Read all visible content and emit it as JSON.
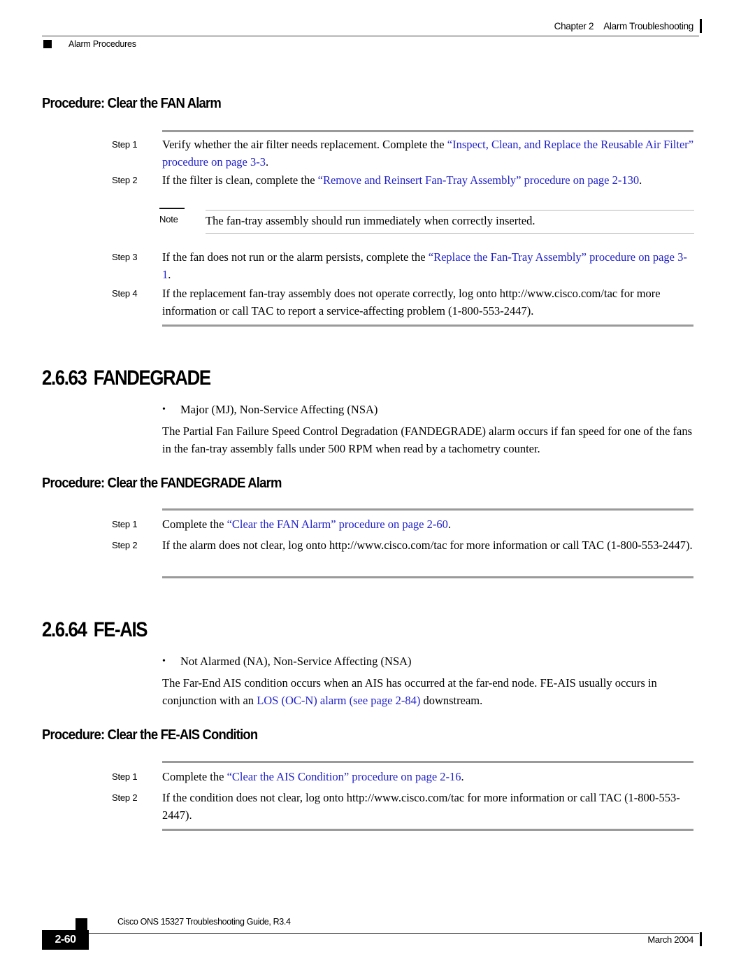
{
  "header": {
    "chapter_number": "Chapter 2",
    "chapter_title": "Alarm Troubleshooting",
    "section_label": "Alarm Procedures"
  },
  "proc_fan": {
    "heading": "Procedure: Clear the FAN Alarm",
    "steps": [
      {
        "label": "Step 1",
        "text_before": "Verify whether the air filter needs replacement. Complete the ",
        "link": "“Inspect, Clean, and Replace the Reusable Air Filter” procedure on page 3-3",
        "text_after": "."
      },
      {
        "label": "Step 2",
        "text_before": "If the filter is clean, complete the ",
        "link": "“Remove and Reinsert Fan-Tray Assembly” procedure on page 2-130",
        "text_after": "."
      },
      {
        "label": "Step 3",
        "text_before": "If the fan does not run or the alarm persists, complete the ",
        "link": "“Replace the Fan-Tray Assembly” procedure on page 3-1",
        "text_after": "."
      },
      {
        "label": "Step 4",
        "text_before": "If the replacement fan-tray assembly does not operate correctly, log onto http://www.cisco.com/tac for more information or call TAC to report a service-affecting problem (1-800-553-2447).",
        "link": "",
        "text_after": ""
      }
    ],
    "note": {
      "label": "Note",
      "text": "The fan-tray assembly should run immediately when correctly inserted."
    }
  },
  "sec_fandegrade": {
    "number": "2.6.63",
    "title": "FANDEGRADE",
    "severity_bullet": "Major (MJ), Non-Service Affecting (NSA)",
    "description": "The Partial Fan Failure Speed Control Degradation (FANDEGRADE) alarm occurs if fan speed for one of the fans in the fan-tray assembly falls under 500 RPM when read by a tachometry counter."
  },
  "proc_fandegrade": {
    "heading": "Procedure: Clear the FANDEGRADE Alarm",
    "steps": [
      {
        "label": "Step 1",
        "text_before": "Complete the ",
        "link": "“Clear the FAN Alarm” procedure on page 2-60",
        "text_after": "."
      },
      {
        "label": "Step 2",
        "text_before": "If the alarm does not clear, log onto http://www.cisco.com/tac for more information or call TAC (1-800-553-2447).",
        "link": "",
        "text_after": ""
      }
    ]
  },
  "sec_feais": {
    "number": "2.6.64",
    "title": "FE-AIS",
    "severity_bullet": "Not Alarmed (NA), Non-Service Affecting (NSA)",
    "desc_before": "The Far-End AIS condition occurs when an AIS has occurred at the far-end node. FE-AIS usually occurs in conjunction with an ",
    "desc_link": "LOS (OC-N) alarm (see page 2-84)",
    "desc_after": " downstream."
  },
  "proc_feais": {
    "heading": "Procedure: Clear the FE-AIS Condition",
    "steps": [
      {
        "label": "Step 1",
        "text_before": "Complete the ",
        "link": "“Clear the AIS Condition” procedure on page 2-16",
        "text_after": "."
      },
      {
        "label": "Step 2",
        "text_before": "If the condition does not clear, log onto http://www.cisco.com/tac for more information or call TAC (1-800-553-2447).",
        "link": "",
        "text_after": ""
      }
    ]
  },
  "footer": {
    "guide_title": "Cisco ONS 15327 Troubleshooting Guide, R3.4",
    "page_number": "2-60",
    "date": "March 2004"
  },
  "colors": {
    "link": "#2222cc",
    "rule_gray": "#9a9a9a",
    "text": "#000000"
  }
}
